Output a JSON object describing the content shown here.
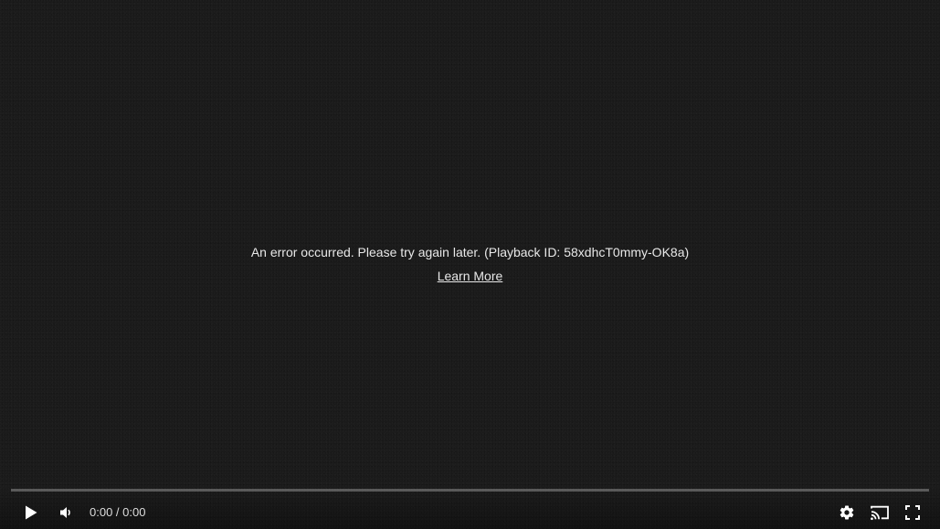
{
  "error": {
    "message": "An error occurred. Please try again later. (Playback ID: 58xdhcT0mmy-OK8a)",
    "learn_more": "Learn More"
  },
  "controls": {
    "current_time": "0:00",
    "separator": " / ",
    "duration": "0:00",
    "progress": 0
  },
  "icons": {
    "play": "play-icon",
    "volume": "volume-icon",
    "settings": "gear-icon",
    "cast": "cast-icon",
    "fullscreen": "fullscreen-icon"
  },
  "colors": {
    "progress_fill": "#ff0000",
    "text": "#e8e8e8"
  }
}
